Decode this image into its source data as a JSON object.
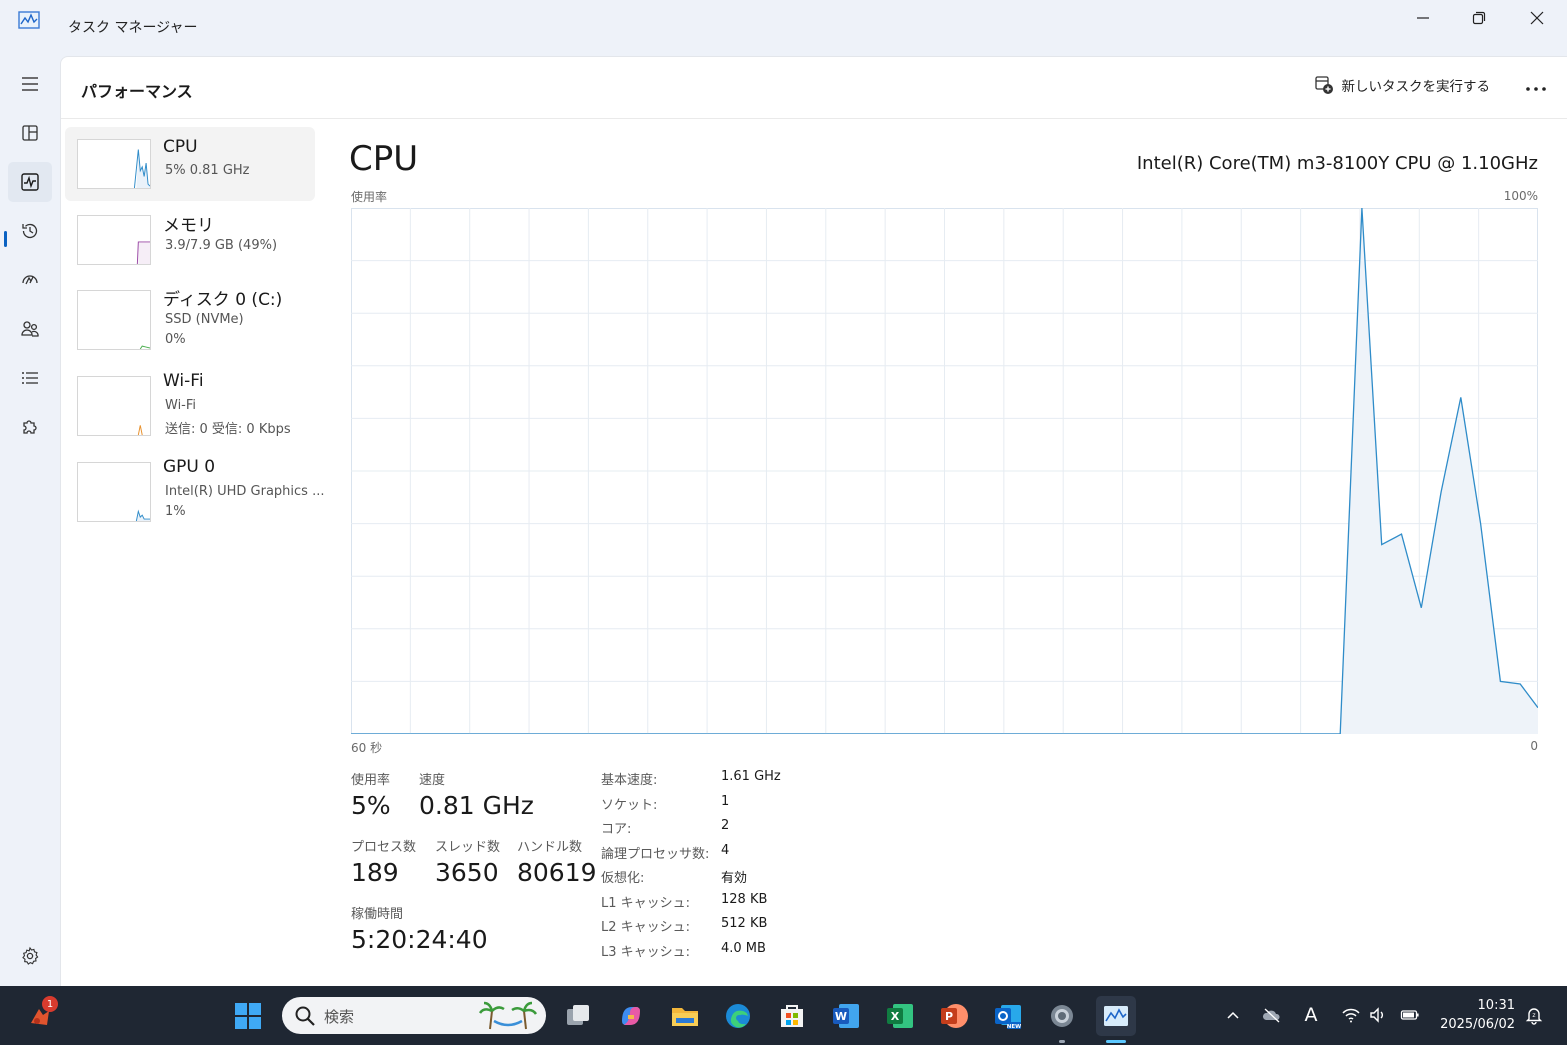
{
  "window": {
    "title": "タスク マネージャー"
  },
  "header": {
    "page_title": "パフォーマンス",
    "run_task_label": "新しいタスクを実行する"
  },
  "resources": [
    {
      "name": "CPU",
      "sub1": "5%  0.81 GHz",
      "sub2": ""
    },
    {
      "name": "メモリ",
      "sub1": "3.9/7.9 GB (49%)",
      "sub2": ""
    },
    {
      "name": "ディスク 0 (C:)",
      "sub1": "SSD (NVMe)",
      "sub2": "0%"
    },
    {
      "name": "Wi-Fi",
      "sub1": "Wi-Fi",
      "sub2": "送信: 0  受信: 0 Kbps"
    },
    {
      "name": "GPU 0",
      "sub1": "Intel(R) UHD Graphics ...",
      "sub2": "1%"
    }
  ],
  "detail": {
    "title": "CPU",
    "model": "Intel(R) Core(TM) m3-8100Y CPU @ 1.10GHz",
    "graph_label_top_left": "使用率",
    "graph_label_top_right": "100%",
    "graph_label_bottom_left": "60 秒",
    "graph_label_bottom_right": "0"
  },
  "chart_data": {
    "type": "area",
    "x_range": [
      60,
      0
    ],
    "ylim": [
      0,
      100
    ],
    "grid": true,
    "color": "#2f8cc9",
    "fill": "#eef3f9",
    "x": [
      60,
      10,
      8.9,
      7.9,
      6.9,
      5.9,
      4.9,
      3.9,
      2.9,
      1.9,
      0.9,
      0
    ],
    "values": [
      0,
      0,
      100,
      36,
      38,
      24,
      46,
      64,
      40,
      10,
      9.5,
      5
    ]
  },
  "stats": {
    "usage_label": "使用率",
    "usage_value": "5%",
    "speed_label": "速度",
    "speed_value": "0.81 GHz",
    "processes_label": "プロセス数",
    "processes_value": "189",
    "threads_label": "スレッド数",
    "threads_value": "3650",
    "handles_label": "ハンドル数",
    "handles_value": "80619",
    "uptime_label": "稼働時間",
    "uptime_value": "5:20:24:40"
  },
  "specs": [
    {
      "label": "基本速度:",
      "value": "1.61 GHz"
    },
    {
      "label": "ソケット:",
      "value": "1"
    },
    {
      "label": "コア:",
      "value": "2"
    },
    {
      "label": "論理プロセッサ数:",
      "value": "4"
    },
    {
      "label": "仮想化:",
      "value": "有効"
    },
    {
      "label": "L1 キャッシュ:",
      "value": "128 KB"
    },
    {
      "label": "L2 キャッシュ:",
      "value": "512 KB"
    },
    {
      "label": "L3 キャッシュ:",
      "value": "4.0 MB"
    }
  ],
  "taskbar": {
    "search_placeholder": "検索",
    "notification_count": "1",
    "time": "10:31",
    "date": "2025/06/02",
    "ime_label": "A"
  }
}
